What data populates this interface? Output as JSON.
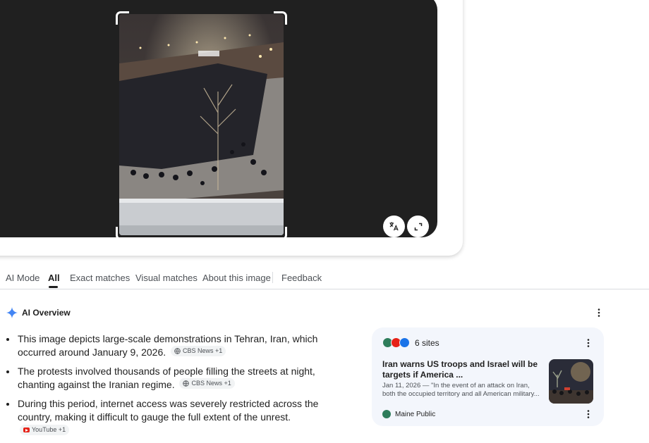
{
  "viewer": {
    "translate_icon": "translate-icon",
    "expand_icon": "expand-icon"
  },
  "tabs": [
    {
      "label": "AI Mode",
      "active": false
    },
    {
      "label": "All",
      "active": true
    },
    {
      "label": "Exact matches",
      "active": false
    },
    {
      "label": "Visual matches",
      "active": false
    },
    {
      "label": "About this image",
      "active": false
    },
    {
      "label": "Feedback",
      "active": false
    }
  ],
  "ai_overview": {
    "title": "AI Overview",
    "icon": "sparkle-icon",
    "accent": "#4285f4",
    "bullets": [
      {
        "text": "This image depicts large-scale demonstrations in Tehran, Iran, which occurred around January 9, 2026.",
        "chip": "CBS News +1",
        "chip_icon": "globe-icon"
      },
      {
        "text": "The protests involved thousands of people filling the streets at night, chanting against the Iranian regime.",
        "chip": "CBS News +1",
        "chip_icon": "globe-icon"
      },
      {
        "text": "During this period, internet access was severely restricted across the country, making it difficult to gauge the full extent of the unrest.",
        "chip": "YouTube +1",
        "chip_icon": "youtube-icon"
      }
    ]
  },
  "sources": {
    "count_label": "6 sites",
    "article": {
      "title": "Iran warns US troops and Israel will be targets if America ...",
      "snippet": "Jan 11, 2026 — \"In the event of an attack on Iran, both the occupied territory and all American military...",
      "publisher": "Maine Public"
    }
  }
}
